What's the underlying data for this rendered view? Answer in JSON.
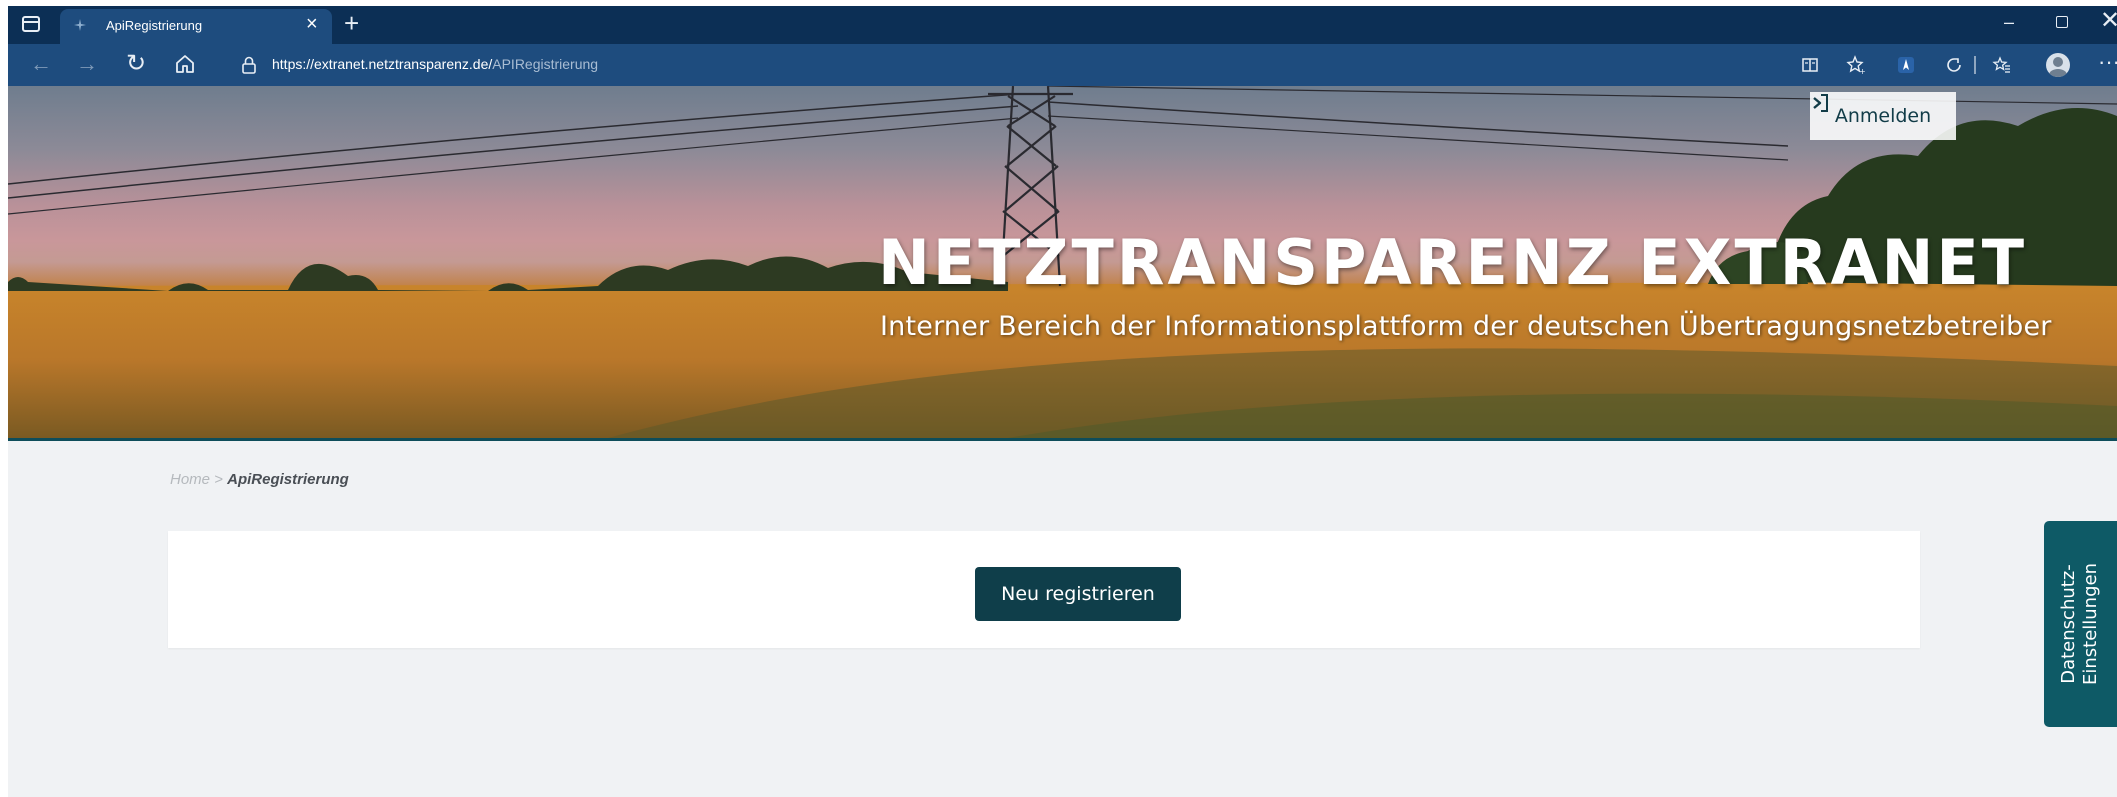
{
  "browser": {
    "tab_title": "ApiRegistrierung",
    "tab_close": "×",
    "new_tab": "+",
    "minimize": "–",
    "close": "✕",
    "url_host": "https://extranet.netztransparenz.de/",
    "url_path": "APIRegistrierung",
    "back": "←",
    "forward": "→",
    "refresh": "↻",
    "more": "···"
  },
  "header": {
    "login_label": "Anmelden",
    "title": "NETZTRANSPARENZ EXTRANET",
    "subtitle": "Interner Bereich der Informationsplattform der deutschen Übertragungsnetzbetreiber"
  },
  "breadcrumb": {
    "home": "Home",
    "separator": " > ",
    "current": "ApiRegistrierung"
  },
  "main": {
    "register_button": "Neu registrieren"
  },
  "privacy": {
    "line1": "Datenschutz-",
    "line2": "Einstellungen"
  },
  "colors": {
    "browser_tabbar": "#0c2f55",
    "browser_toolbar": "#1e4c7e",
    "primary_button": "#0f3e4a",
    "privacy_tab": "#0e5a66",
    "page_background": "#f0f2f4"
  }
}
